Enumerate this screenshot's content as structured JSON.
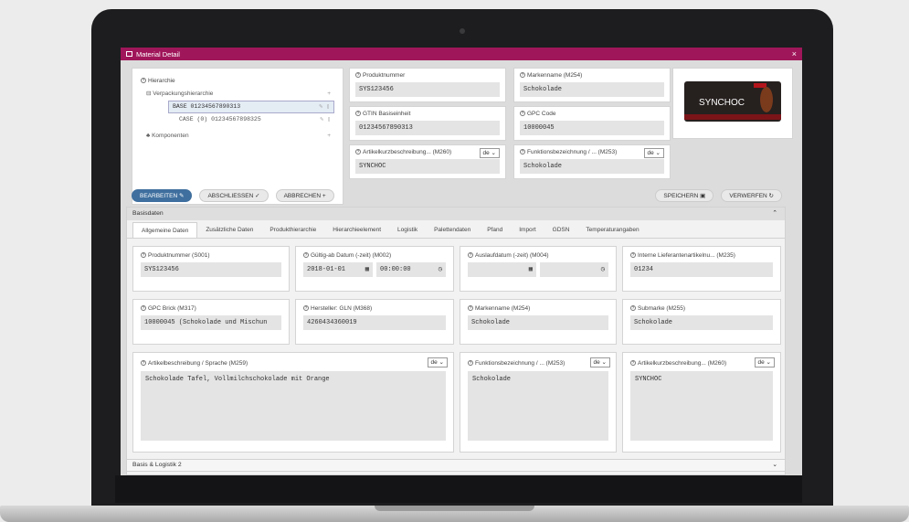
{
  "window": {
    "title": "Material Detail"
  },
  "hierarchy": {
    "title": "Hierarchie",
    "packaging": "Verpackungshierarchie",
    "base": "BASE 01234567890313",
    "case": "CASE (0) 01234567898325",
    "components": "Komponenten"
  },
  "header_fields": {
    "produktnummer": {
      "label": "Produktnummer",
      "value": "SYS123456"
    },
    "markenname": {
      "label": "Markenname (M254)",
      "value": "Schokolade"
    },
    "gtin": {
      "label": "GTIN Basiseinheit",
      "value": "01234567890313"
    },
    "gpc": {
      "label": "GPC Code",
      "value": "10000045"
    },
    "artikelkurz": {
      "label": "Artikelkurzbeschreibung... (M260)",
      "lang": "de",
      "value": "SYNCHOC"
    },
    "funktion": {
      "label": "Funktionsbezeichnung / ... (M253)",
      "lang": "de",
      "value": "Schokolade"
    }
  },
  "product_image": {
    "brand": "SYNCHOC"
  },
  "toolbar": {
    "edit": "BEARBEITEN",
    "finish": "ABSCHLIESSEN",
    "cancel": "ABBRECHEN",
    "save": "SPEICHERN",
    "discard": "VERWERFEN"
  },
  "basisdaten": {
    "title": "Basisdaten",
    "tabs": [
      "Allgemeine Daten",
      "Zusätzliche Daten",
      "Produkthierarchie",
      "Hierarchieelement",
      "Logistik",
      "Palettendaten",
      "Pfand",
      "Import",
      "GDSN",
      "Temperaturangaben"
    ],
    "fields": {
      "s001": {
        "label": "Produktnummer (S001)",
        "value": "SYS123456"
      },
      "m002": {
        "label": "Gültig-ab Datum (-zeit) (M002)",
        "date": "2018-01-01",
        "time": "00:00:00"
      },
      "m004": {
        "label": "Auslaufdatum (-zeit) (M004)",
        "date": "",
        "time": ""
      },
      "m235": {
        "label": "Interne Lieferantenartikelnu... (M235)",
        "value": "01234"
      },
      "m317": {
        "label": "GPC Brick (M317)",
        "value": "10000045 (Schokolade und Mischun"
      },
      "m368": {
        "label": "Hersteller: GLN (M368)",
        "value": "4260434360019"
      },
      "m254": {
        "label": "Markenname (M254)",
        "value": "Schokolade"
      },
      "m255": {
        "label": "Submarke (M255)",
        "value": "Schokolade"
      },
      "m259": {
        "label": "Artikelbeschreibung / Sprache (M259)",
        "lang": "de",
        "value": "Schokolade Tafel, Vollmilchschokolade mit Orange"
      },
      "m253": {
        "label": "Funktionsbezeichnung / ... (M253)",
        "lang": "de",
        "value": "Schokolade"
      },
      "m260": {
        "label": "Artikelkurzbeschreibung... (M260)",
        "lang": "de",
        "value": "SYNCHOC"
      }
    }
  },
  "footer": {
    "title": "Basis & Logistik 2"
  },
  "colors": {
    "accent": "#a0165a",
    "primary": "#3f6f9e"
  }
}
